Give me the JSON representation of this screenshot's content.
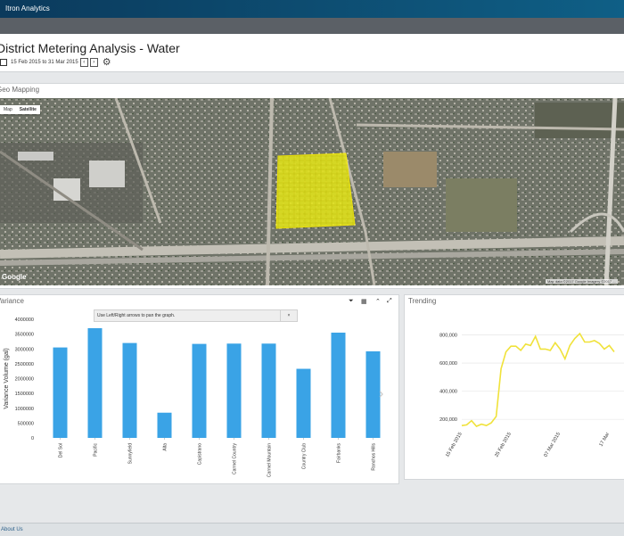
{
  "app": {
    "title": "Itron Analytics"
  },
  "page": {
    "title": "District Metering Analysis - Water",
    "date_range": "15 Feb 2015 to 31 Mar 2015"
  },
  "geo_panel": {
    "title": "Geo Mapping",
    "map_type_options": [
      "Map",
      "Satellite"
    ],
    "selected_map_type": "Satellite",
    "attribution": "Google",
    "footer_text": "Map data ©2017 Google Imagery ©2017 ...",
    "highlight_color": "#e4e51b"
  },
  "variance_panel": {
    "title": "Variance",
    "tooltip_text": "Use Left/Right arrows to pan the graph.",
    "tooltip_close": "×",
    "toolbar_icons": [
      "filter-icon",
      "table-icon",
      "collapse-icon",
      "expand-icon"
    ]
  },
  "trending_panel": {
    "title": "Trending"
  },
  "footer": {
    "link": "About Us"
  },
  "chart_data": [
    {
      "type": "bar",
      "title": "",
      "xlabel": "",
      "ylabel": "Variance Volume (gal)",
      "ylim": [
        0,
        4000000
      ],
      "yticks": [
        "4000000",
        "3500000",
        "3000000",
        "2500000",
        "2000000",
        "1500000",
        "1000000",
        "500000",
        "0"
      ],
      "categories": [
        "Del Sol",
        "Pacific",
        "Sunnyfield",
        "Alta",
        "Capistrano",
        "Carmel Country",
        "Carmel Mountain",
        "Country Club",
        "Fairbanks",
        "Ranchos Hills"
      ],
      "values": [
        3050000,
        3700000,
        3200000,
        850000,
        3170000,
        3180000,
        3180000,
        2330000,
        3550000,
        2920000
      ],
      "color": "#3aa3e6"
    },
    {
      "type": "line",
      "title": "",
      "xlabel": "",
      "ylabel": "",
      "ylim": [
        150000,
        880000
      ],
      "yticks": [
        "800,000",
        "600,000",
        "400,000",
        "200,000"
      ],
      "xticks": [
        "15 Feb 2015",
        "25 Feb 2015",
        "07 Mar 2015",
        "17 Mar"
      ],
      "x": [
        0,
        1,
        2,
        3,
        4,
        5,
        6,
        7,
        8,
        9,
        10,
        11,
        12,
        13,
        14,
        15,
        16,
        17,
        18,
        19,
        20,
        21,
        22,
        23,
        24,
        25,
        26,
        27,
        28,
        29,
        30,
        31
      ],
      "values": [
        155000,
        160000,
        190000,
        150000,
        165000,
        155000,
        175000,
        220000,
        560000,
        680000,
        720000,
        720000,
        690000,
        735000,
        725000,
        790000,
        700000,
        700000,
        690000,
        745000,
        700000,
        630000,
        725000,
        775000,
        810000,
        750000,
        750000,
        760000,
        740000,
        700000,
        725000,
        680000
      ],
      "color": "#f0e23a"
    }
  ]
}
